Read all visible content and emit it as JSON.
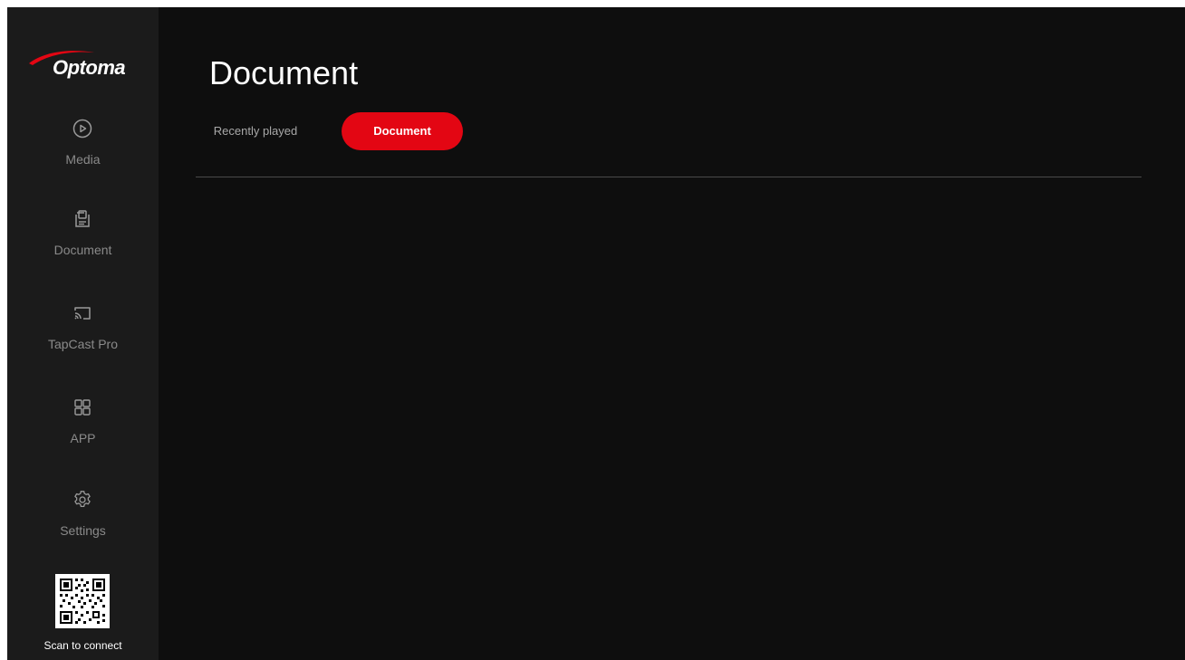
{
  "brand": {
    "logo_text": "Optoma",
    "accent_color": "#e30613"
  },
  "sidebar": {
    "items": [
      {
        "label": "Media",
        "icon": "play-circle-icon"
      },
      {
        "label": "Document",
        "icon": "document-icon"
      },
      {
        "label": "TapCast Pro",
        "icon": "cast-icon"
      },
      {
        "label": "APP",
        "icon": "apps-grid-icon"
      },
      {
        "label": "Settings",
        "icon": "gear-icon"
      }
    ],
    "qr_label": "Scan to connect"
  },
  "main": {
    "title": "Document",
    "tabs": [
      {
        "label": "Recently played",
        "active": false
      },
      {
        "label": "Document",
        "active": true
      }
    ]
  }
}
